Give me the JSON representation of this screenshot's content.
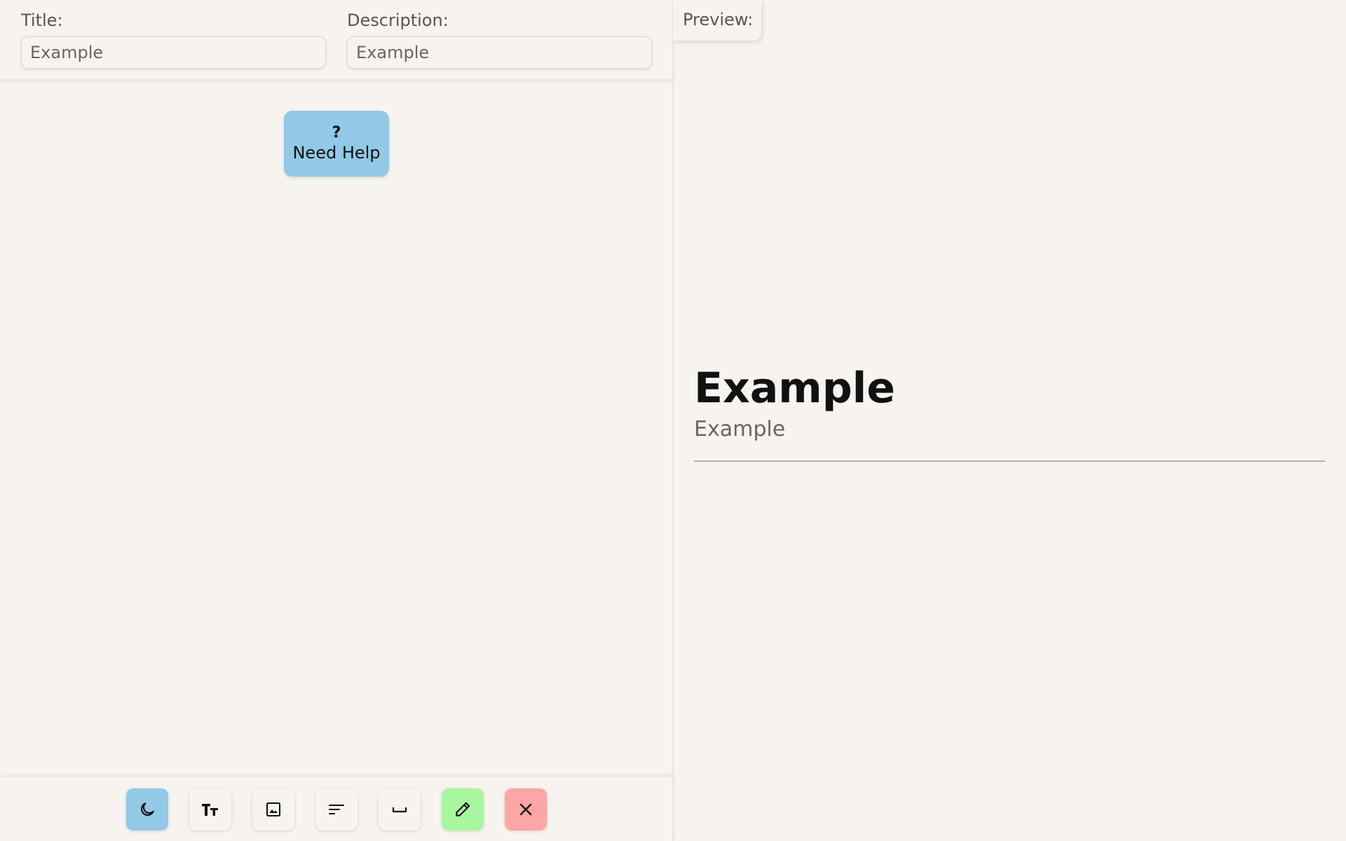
{
  "editor": {
    "title_field": {
      "label": "Title:",
      "placeholder": "Example"
    },
    "description_field": {
      "label": "Description:",
      "placeholder": "Example"
    },
    "help_button": {
      "icon": "?",
      "label": "Need Help"
    }
  },
  "toolbar": {
    "buttons": [
      {
        "name": "dark-mode-toggle",
        "icon": "moon-icon",
        "color": "#91c9e6"
      },
      {
        "name": "text-size-button",
        "icon": "text-size-icon",
        "color": "#f7f4ef"
      },
      {
        "name": "insert-image-button",
        "icon": "image-icon",
        "color": "#f7f4ef"
      },
      {
        "name": "align-text-button",
        "icon": "align-left-icon",
        "color": "#f7f4ef"
      },
      {
        "name": "insert-space-button",
        "icon": "space-icon",
        "color": "#f7f4ef"
      },
      {
        "name": "edit-button",
        "icon": "pencil-icon",
        "color": "#a8f7a0"
      },
      {
        "name": "close-button",
        "icon": "close-icon",
        "color": "#ffa5a5"
      }
    ]
  },
  "preview": {
    "tab_label": "Preview:",
    "title": "Example",
    "description": "Example"
  },
  "colors": {
    "background": "#f7f4ef",
    "accent_blue": "#91c9e6",
    "accent_green": "#a8f7a0",
    "accent_red": "#ffa5a5"
  }
}
